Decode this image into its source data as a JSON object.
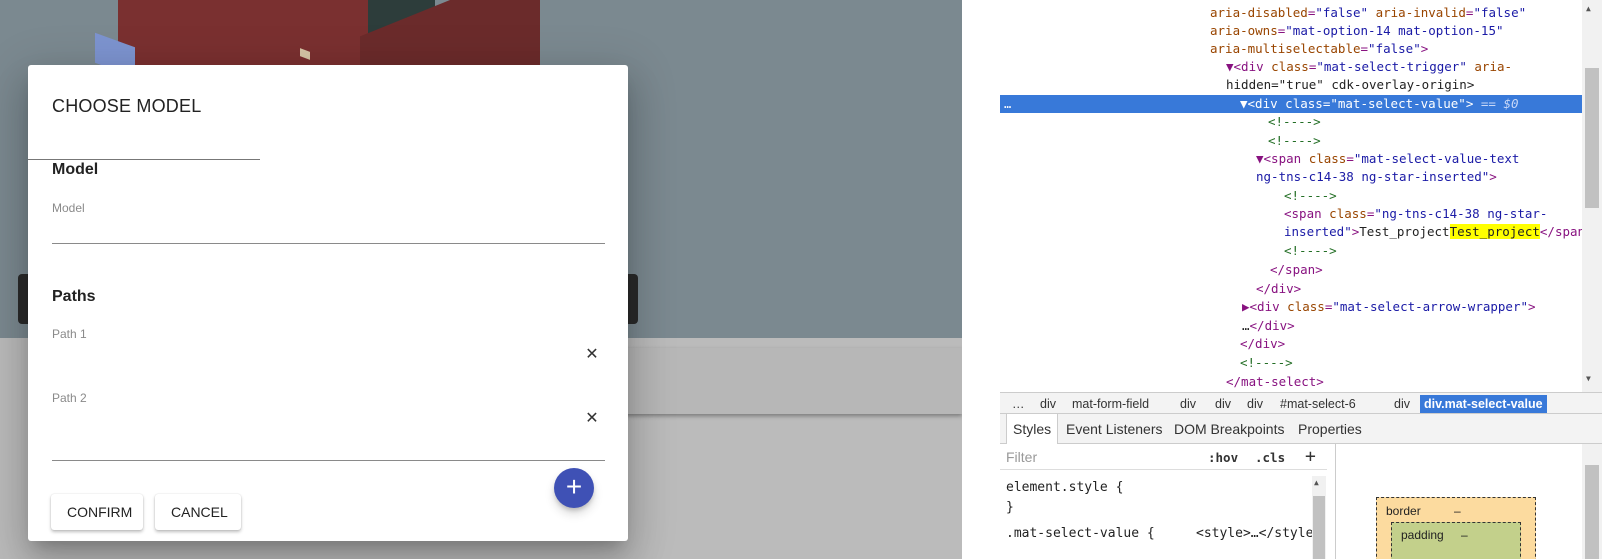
{
  "dialog": {
    "title": "CHOOSE MODEL",
    "model_section": "Model",
    "model_label": "Model",
    "model_value": "",
    "paths_section": "Paths",
    "path1_label": "Path 1",
    "path1_value": "",
    "path2_label": "Path 2",
    "path2_value": "",
    "clear_glyph": "✕",
    "add_glyph": "+",
    "confirm_label": "CONFIRM",
    "cancel_label": "CANCEL",
    "accent_color": "#3f51b5"
  },
  "devtools": {
    "dom_lines": [
      {
        "a1": "aria-disabled",
        "v1": "\"false\"",
        "a2": "aria-invalid",
        "v2": "\"false\""
      },
      {
        "a1": "aria-owns",
        "v1": "\"mat-option-14 mat-option-15\""
      },
      {
        "a1": "aria-multiselectable",
        "v1": "\"false\"",
        "end": ">"
      },
      {
        "arrow": "▼",
        "tag": "<div",
        "a1": "class",
        "v1": "\"mat-select-trigger\"",
        "a2": "aria-"
      },
      {
        "text": "hidden=\"true\" cdk-overlay-origin>"
      },
      {
        "arrow": "▼",
        "tag": "<div",
        "a1": "class",
        "v1": "\"mat-select-value\"",
        "end": ">",
        "eq": "== $0"
      },
      {
        "comment": "<!---->"
      },
      {
        "comment": "<!---->"
      },
      {
        "arrow": "▼",
        "tag": "<span",
        "a1": "class",
        "v1": "\"mat-select-value-text"
      },
      {
        "v1": "ng-tns-c14-38 ng-star-inserted\"",
        "end": ">"
      },
      {
        "comment": "<!---->"
      },
      {
        "tag": "<span",
        "a1": "class",
        "v1": "\"ng-tns-c14-38 ng-star-"
      },
      {
        "v1": "inserted\"",
        "end": ">",
        "text": "Test_project",
        "close": "</span>"
      },
      {
        "comment": "<!---->"
      },
      {
        "tag": "</span>"
      },
      {
        "tag": "</div>"
      },
      {
        "arrow": "▶",
        "tag": "<div",
        "a1": "class",
        "v1": "\"mat-select-arrow-wrapper\"",
        "end": ">"
      },
      {
        "text": "…",
        "tag": "</div>"
      },
      {
        "tag": "</div>"
      },
      {
        "comment": "<!---->"
      },
      {
        "tag": "</mat-select>"
      }
    ],
    "selected_dots": "…",
    "breadcrumbs": [
      "…",
      "div",
      "mat-form-field",
      "div",
      "div",
      "div",
      "#mat-select-6",
      "div",
      "div.mat-select-value"
    ],
    "tabs": [
      "Styles",
      "Event Listeners",
      "DOM Breakpoints",
      "Properties"
    ],
    "filter_placeholder": "Filter",
    "hov": ":hov",
    "cls": ".cls",
    "plus": "+",
    "rule1_selector": "element.style {",
    "rule1_close": "}",
    "rule2_selector": ".mat-select-value {",
    "rule2_source": "<style>…</style>",
    "box_border_label": "border",
    "box_border_value": "–",
    "box_padding_label": "padding",
    "box_padding_value": "–",
    "highlight_color": "#ffff00",
    "selection_color": "#3879d9"
  }
}
